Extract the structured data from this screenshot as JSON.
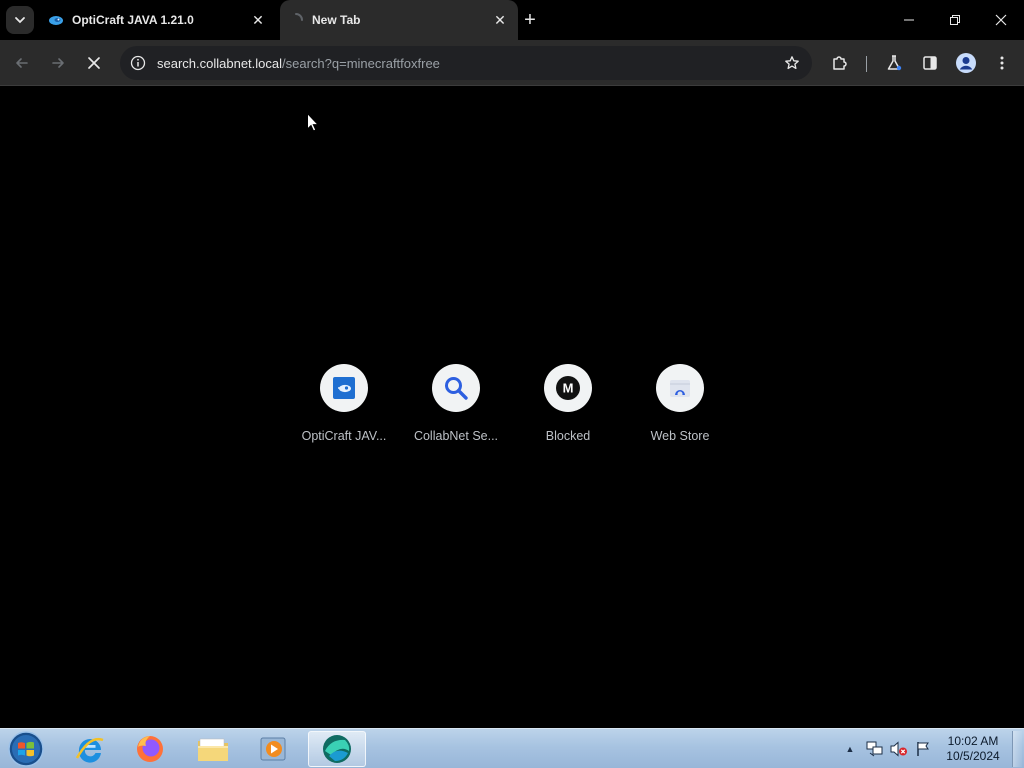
{
  "tabs": [
    {
      "title": "OptiCraft JAVA 1.21.0",
      "favicon": "opticraft-favicon",
      "active": false
    },
    {
      "title": "New Tab",
      "favicon": "loading-spinner",
      "active": true
    }
  ],
  "tabstrip": {
    "close_glyph": "✕",
    "new_tab_glyph": "+"
  },
  "toolbar": {
    "url_host": "search.collabnet.local",
    "url_path": "/search?q=minecraftfoxfree"
  },
  "shortcuts": [
    {
      "label": "OptiCraft JAV...",
      "icon": "opticraft-icon"
    },
    {
      "label": "CollabNet Se...",
      "icon": "magnifier-icon"
    },
    {
      "label": "Blocked",
      "icon": "m-logo-icon",
      "icon_text": "M"
    },
    {
      "label": "Web Store",
      "icon": "web-store-icon"
    }
  ],
  "taskbar": {
    "apps": [
      "internet-explorer-icon",
      "firefox-icon",
      "file-explorer-icon",
      "media-player-icon",
      "browser-icon"
    ],
    "clock_time": "10:02 AM",
    "clock_date": "10/5/2024",
    "tray_arrow": "▲"
  },
  "colors": {
    "accent": "#3b82f6",
    "toolbar_bg": "#2b2b2b",
    "omnibox_bg": "#202124",
    "taskbar_top": "#bcd3ea",
    "taskbar_bottom": "#98b6d8"
  }
}
